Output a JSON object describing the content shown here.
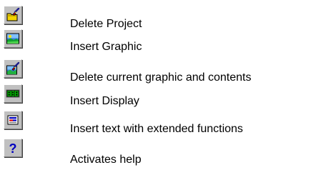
{
  "items": [
    {
      "label": "Delete Project",
      "icon": "delete-project-icon"
    },
    {
      "label": "Insert Graphic",
      "icon": "insert-graphic-icon"
    },
    {
      "label": "Delete current graphic and contents",
      "icon": "delete-graphic-icon"
    },
    {
      "label": "Insert Display",
      "icon": "insert-display-icon"
    },
    {
      "label": "Insert text with extended functions",
      "icon": "insert-text-icon"
    },
    {
      "label": "Activates help",
      "icon": "help-icon"
    }
  ],
  "colors": {
    "button_face": "#c0c0c0",
    "display_green": "#00c000",
    "help_blue": "#0000c0"
  }
}
